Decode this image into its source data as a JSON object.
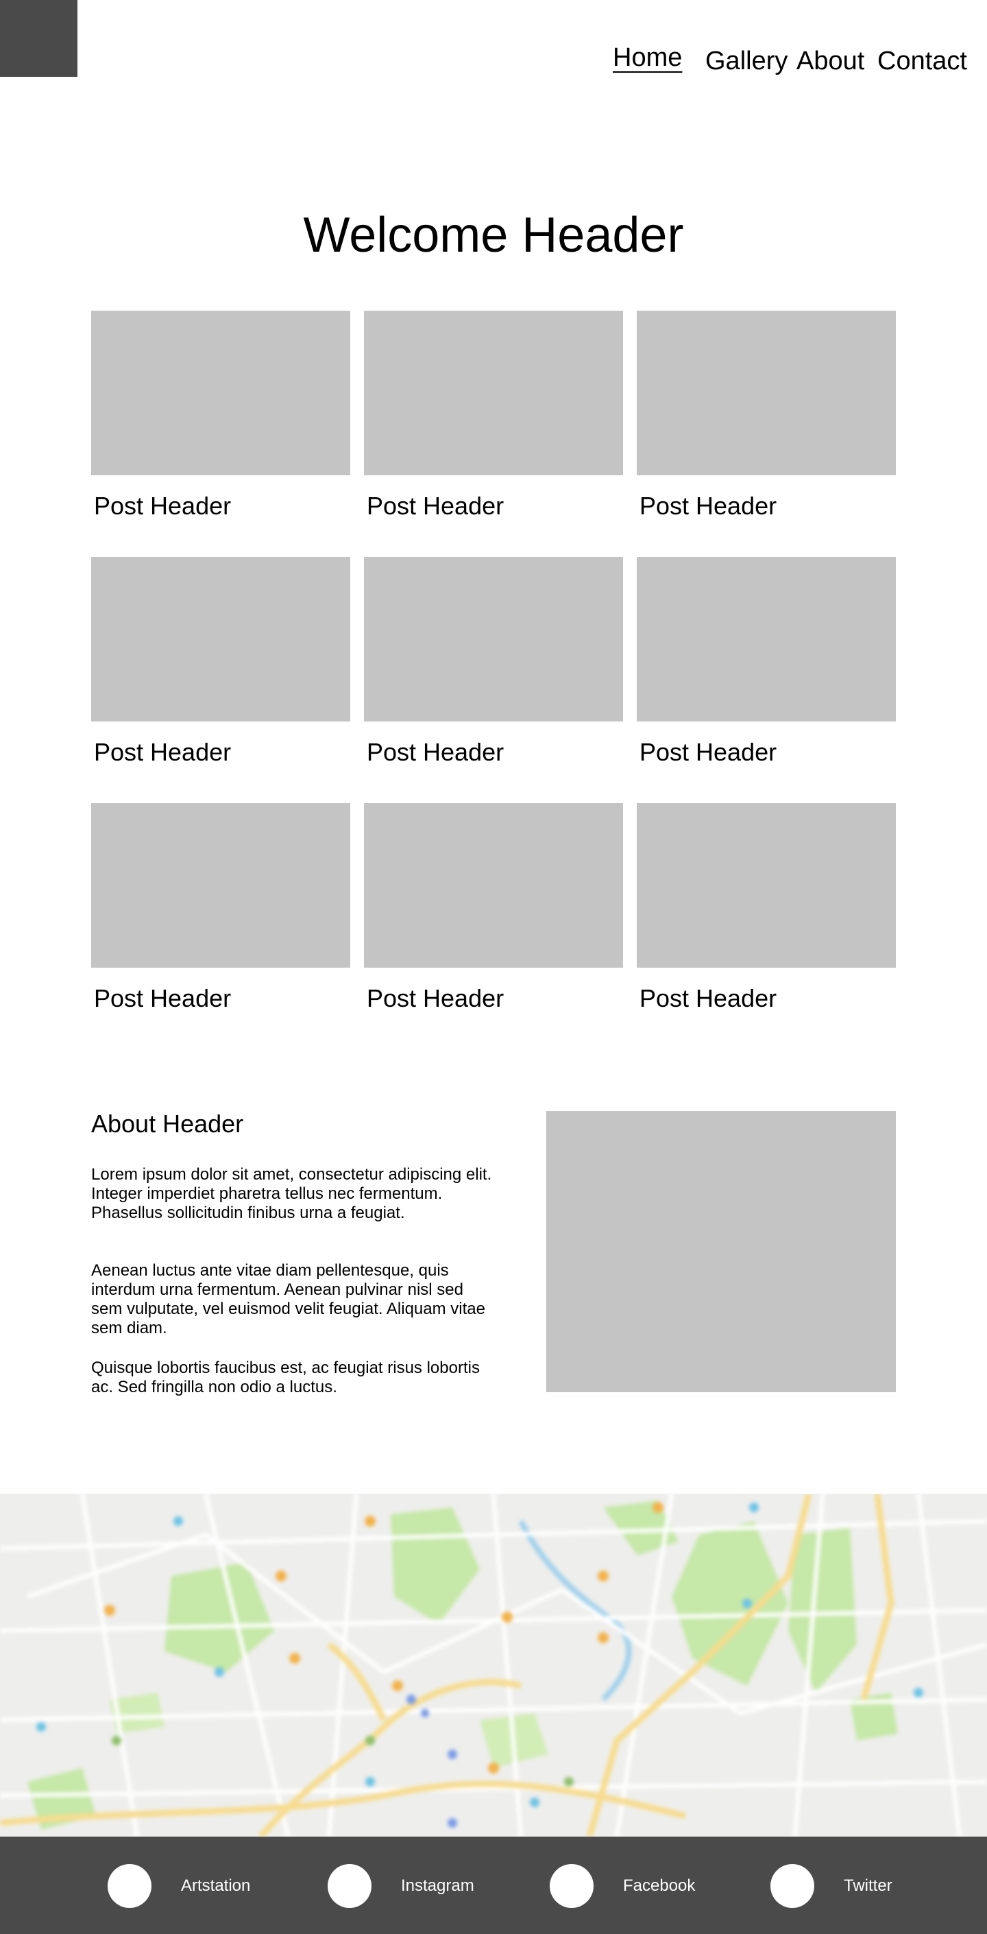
{
  "colors": {
    "logo": "#4a4a4a",
    "placeholder": "#c4c4c4",
    "footer": "#4a4a4a"
  },
  "nav": {
    "home": "Home",
    "gallery": "Gallery",
    "about": "About",
    "contact": "Contact",
    "active": "home"
  },
  "welcome": "Welcome Header",
  "posts": [
    {
      "title": "Post Header"
    },
    {
      "title": "Post Header"
    },
    {
      "title": "Post Header"
    },
    {
      "title": "Post Header"
    },
    {
      "title": "Post Header"
    },
    {
      "title": "Post Header"
    },
    {
      "title": "Post Header"
    },
    {
      "title": "Post Header"
    },
    {
      "title": "Post Header"
    }
  ],
  "about": {
    "title": "About Header",
    "paragraphs": [
      "Lorem ipsum dolor sit amet, consectetur adipiscing elit. Integer imperdiet pharetra tellus nec fermentum. Phasellus sollicitudin finibus urna a feugiat.",
      "Aenean luctus ante vitae diam pellentesque, quis interdum urna fermentum. Aenean pulvinar nisl sed sem vulputate, vel euismod velit feugiat. Aliquam vitae sem diam.",
      "Quisque lobortis faucibus est, ac feugiat risus lobortis ac. Sed fringilla non odio a luctus."
    ]
  },
  "social": [
    {
      "label": "Artstation",
      "icon": "artstation-icon"
    },
    {
      "label": "Instagram",
      "icon": "instagram-icon"
    },
    {
      "label": "Facebook",
      "icon": "facebook-icon"
    },
    {
      "label": "Twitter",
      "icon": "twitter-icon"
    }
  ]
}
